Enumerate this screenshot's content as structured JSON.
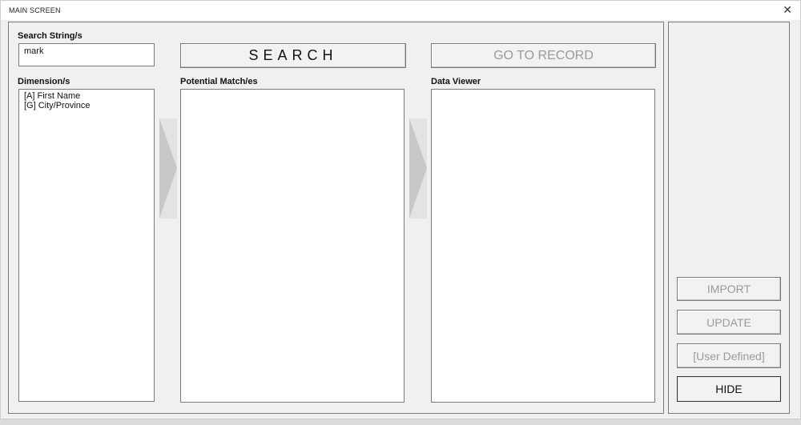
{
  "window": {
    "title": "MAIN SCREEN",
    "close_glyph": "✕"
  },
  "search": {
    "label": "Search String/s",
    "value": "mark",
    "button_label": "SEARCH"
  },
  "goto": {
    "button_label": "GO TO RECORD"
  },
  "dimensions": {
    "label": "Dimension/s",
    "items": [
      "[A] First Name",
      "[G] City/Province"
    ]
  },
  "matches": {
    "label": "Potential Match/es"
  },
  "viewer": {
    "label": "Data Viewer"
  },
  "side": {
    "import_label": "IMPORT",
    "update_label": "UPDATE",
    "user_defined_label": "[User Defined]",
    "hide_label": "HIDE"
  },
  "icons": {
    "arrow_left": "chevron-right-icon",
    "arrow_right": "chevron-right-icon",
    "close": "close-icon"
  },
  "colors": {
    "background": "#f0f0f0",
    "disabled_text": "#9a9a9a",
    "border": "#7a7a7a"
  }
}
